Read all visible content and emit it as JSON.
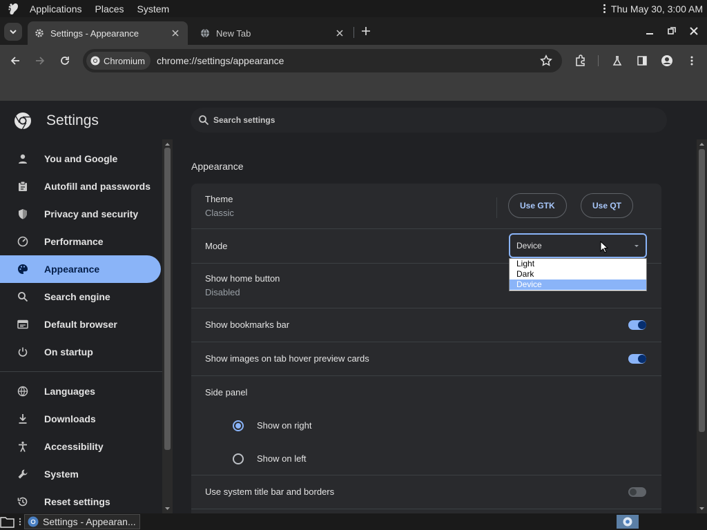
{
  "system_panel": {
    "menus": [
      "Applications",
      "Places",
      "System"
    ],
    "clock": "Thu May 30,  3:00 AM"
  },
  "tabs": [
    {
      "title": "Settings - Appearance",
      "active": true
    },
    {
      "title": "New Tab",
      "active": false
    }
  ],
  "toolbar": {
    "chip_label": "Chromium",
    "url_scheme_host": "chrome://settings",
    "url_path": "/appearance"
  },
  "settings": {
    "title": "Settings",
    "search_placeholder": "Search settings"
  },
  "sidebar": {
    "items": [
      {
        "label": "You and Google",
        "icon": "person-icon"
      },
      {
        "label": "Autofill and passwords",
        "icon": "clipboard-icon"
      },
      {
        "label": "Privacy and security",
        "icon": "shield-icon"
      },
      {
        "label": "Performance",
        "icon": "speedometer-icon"
      },
      {
        "label": "Appearance",
        "icon": "palette-icon",
        "selected": true
      },
      {
        "label": "Search engine",
        "icon": "search-icon"
      },
      {
        "label": "Default browser",
        "icon": "browser-window-icon"
      },
      {
        "label": "On startup",
        "icon": "power-icon"
      },
      {
        "label": "Languages",
        "icon": "globe-icon"
      },
      {
        "label": "Downloads",
        "icon": "download-icon"
      },
      {
        "label": "Accessibility",
        "icon": "accessibility-icon"
      },
      {
        "label": "System",
        "icon": "wrench-icon"
      },
      {
        "label": "Reset settings",
        "icon": "history-icon"
      }
    ]
  },
  "appearance": {
    "section_title": "Appearance",
    "theme": {
      "label": "Theme",
      "value": "Classic",
      "buttons": [
        "Use GTK",
        "Use QT"
      ]
    },
    "mode": {
      "label": "Mode",
      "selected": "Device",
      "options": [
        "Light",
        "Dark",
        "Device"
      ]
    },
    "home_button": {
      "label": "Show home button",
      "value": "Disabled"
    },
    "bookmarks_bar": {
      "label": "Show bookmarks bar",
      "enabled": true
    },
    "hover_cards": {
      "label": "Show images on tab hover preview cards",
      "enabled": true
    },
    "side_panel": {
      "label": "Side panel",
      "options": [
        "Show on right",
        "Show on left"
      ],
      "selected": "Show on right"
    },
    "system_title_bar": {
      "label": "Use system title bar and borders",
      "enabled": false
    }
  },
  "taskbar": {
    "task_label": "Settings - Appearan..."
  },
  "colors": {
    "accent": "#8ab4f8",
    "background": "#202124",
    "card": "#292a2d"
  }
}
